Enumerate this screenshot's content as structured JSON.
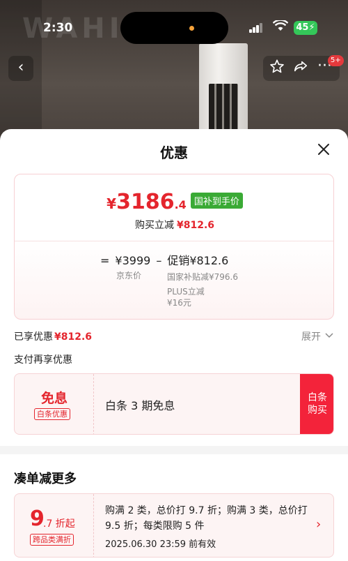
{
  "status_bar": {
    "time": "2:30",
    "battery": "45"
  },
  "background": {
    "brand_text": "WAHIN"
  },
  "nav": {
    "back_icon": "chevron-left-icon",
    "badge": "5+"
  },
  "sheet": {
    "title": "优惠",
    "close_icon": "close-icon"
  },
  "price_card": {
    "currency": "¥",
    "price_int": "3186",
    "price_dec": ".4",
    "tag": "国补到手价",
    "buy_discount_label": "购买立减",
    "buy_discount_value": "¥812.6",
    "calc_eq": "=",
    "base_price": "¥3999",
    "calc_minus": "–",
    "promo_total": "促销¥812.6",
    "base_label": "京东价",
    "detail_subsidy": "国家补贴减¥796.6",
    "detail_plus": "PLUS立减¥16元"
  },
  "enjoyed": {
    "label": "已享优惠",
    "value": "¥812.6",
    "expand": "展开"
  },
  "pay_again": "支付再享优惠",
  "baitiao": {
    "main": "免息",
    "chip": "白条优惠",
    "text": "白条 3 期免息",
    "button": "白条\n购买"
  },
  "more": {
    "title": "凑单减更多",
    "big": "9",
    "small": ".7 折起",
    "chip": "跨品类满折",
    "text": "购满 2 类，总价打 9.7 折；购满 3 类，总价打 9.5 折；每类限购 5 件",
    "date": "2025.06.30 23:59 前有效"
  },
  "colors": {
    "accent_red": "#e4252d",
    "tag_green": "#3aaa35",
    "button_red": "#f3233a"
  }
}
